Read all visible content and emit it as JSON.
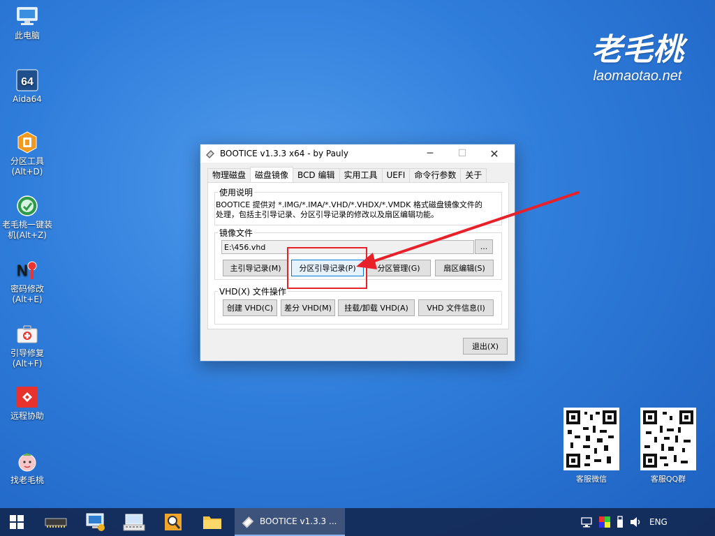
{
  "desktop": {
    "icons": [
      {
        "label": "此电脑",
        "icon": "computer-icon"
      },
      {
        "label": "Aida64",
        "icon": "aida64-icon",
        "badge": "64"
      },
      {
        "label": "分区工具\n(Alt+D)",
        "icon": "partition-tool-icon"
      },
      {
        "label": "老毛桃一键装\n机(Alt+Z)",
        "icon": "one-key-install-icon"
      },
      {
        "label": "密码修改\n(Alt+E)",
        "icon": "password-change-icon"
      },
      {
        "label": "引导修复\n(Alt+F)",
        "icon": "boot-repair-icon"
      },
      {
        "label": "远程协助",
        "icon": "remote-assist-icon"
      },
      {
        "label": "找老毛桃",
        "icon": "find-laomaotao-icon"
      }
    ],
    "brand": {
      "chinese": "老毛桃",
      "url": "laomaotao.net"
    },
    "qr_codes": [
      {
        "label": "客服微信",
        "icon": "qr-code-icon"
      },
      {
        "label": "客服QQ群",
        "icon": "qr-code-icon"
      }
    ]
  },
  "window": {
    "title": "BOOTICE v1.3.3 x64 - by Pauly",
    "controls": {
      "minimize": "─",
      "maximize": "☐",
      "close": "✕"
    },
    "tabs": [
      {
        "label": "物理磁盘",
        "active": false
      },
      {
        "label": "磁盘镜像",
        "active": true
      },
      {
        "label": "BCD 编辑",
        "active": false
      },
      {
        "label": "实用工具",
        "active": false
      },
      {
        "label": "UEFI",
        "active": false
      },
      {
        "label": "命令行参数",
        "active": false
      },
      {
        "label": "关于",
        "active": false
      }
    ],
    "usage": {
      "legend": "使用说明",
      "line1": "BOOTICE 提供对 *.IMG/*.IMA/*.VHD/*.VHDX/*.VMDK 格式磁盘镜像文件的",
      "line2": "处理，包括主引导记录、分区引导记录的修改以及扇区编辑功能。"
    },
    "image_file": {
      "legend": "镜像文件",
      "path": "E:\\456.vhd",
      "browse_label": "...",
      "buttons": {
        "mbr": "主引导记录(M)",
        "pbr": "分区引导记录(P)",
        "partition_manage": "分区管理(G)",
        "sector_edit": "扇区编辑(S)"
      }
    },
    "vhd_ops": {
      "legend": "VHD(X) 文件操作",
      "buttons": {
        "create": "创建 VHD(C)",
        "diff": "差分 VHD(M)",
        "mount": "挂载/卸载 VHD(A)",
        "info": "VHD 文件信息(I)"
      }
    },
    "exit_label": "退出(X)"
  },
  "annotation": {
    "color": "#e8202a"
  },
  "taskbar": {
    "start_icon": "windows-start-icon",
    "pinned": [
      "ram-chip-icon",
      "network-computer-icon",
      "keyboard-icon",
      "search-tool-icon",
      "folder-icon"
    ],
    "active_task": {
      "label": "BOOTICE v1.3.3 ...",
      "icon": "bootice-app-icon"
    },
    "tray": {
      "language": "ENG",
      "icons": [
        "network-icon",
        "color-palette-icon",
        "usb-drive-icon",
        "volume-icon"
      ]
    }
  },
  "colors": {
    "accent": "#0078d7",
    "desktop": "#2f7ddb",
    "highlight": "#e8202a"
  }
}
